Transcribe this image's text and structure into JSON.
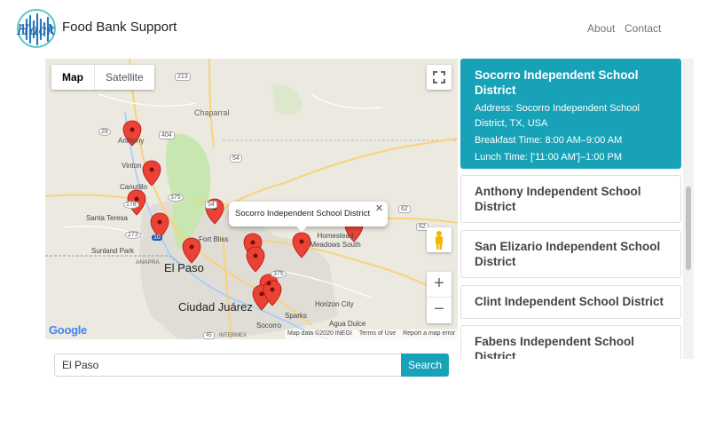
{
  "navbar": {
    "brand": "Food Bank Support",
    "logo_text": "Hack",
    "links": [
      "About",
      "Contact"
    ]
  },
  "map": {
    "type_controls": [
      "Map",
      "Satellite"
    ],
    "selected_type": "Map",
    "info_window": "Socorro Independent School District",
    "zoom_in": "+",
    "zoom_out": "−",
    "google_logo": "Google",
    "attribution": [
      "Map data ©2020 INEGI",
      "Terms of Use",
      "Report a map error"
    ],
    "place_labels": [
      "Chaparral",
      "Anthony",
      "Vinton",
      "Canutillo",
      "Santa Teresa",
      "Sunland Park",
      "ANAPRA",
      "El Paso",
      "Fort Bliss",
      "Homestead Meadows South",
      "Ciudad Juárez",
      "Horizon City",
      "Sparks",
      "Agua Dulce",
      "Socorro",
      "INTERMEX"
    ],
    "road_labels": [
      "213",
      "404",
      "28",
      "54",
      "375",
      "178",
      "273",
      "10",
      "54",
      "62",
      "62",
      "375",
      "45"
    ],
    "marker_count": 13,
    "colors": {
      "marker": "#ea4335",
      "water": "#a3ccff",
      "park": "#c8e6b0",
      "road": "#f9d27b",
      "urban": "#e0ddd6"
    }
  },
  "search": {
    "value": "El Paso",
    "button": "Search"
  },
  "districts": [
    {
      "name": "Socorro Independent School District",
      "active": true,
      "address": "Address: Socorro Independent School District, TX, USA",
      "breakfast": "Breakfast Time: 8:00 AM–9:00 AM",
      "lunch": "Lunch Time: ['11:00 AM']–1:00 PM"
    },
    {
      "name": "Anthony Independent School District",
      "active": false
    },
    {
      "name": "San Elizario Independent School District",
      "active": false
    },
    {
      "name": "Clint Independent School District",
      "active": false
    },
    {
      "name": "Fabens Independent School District",
      "active": false
    }
  ],
  "theme": {
    "accent": "#17a2b8"
  }
}
